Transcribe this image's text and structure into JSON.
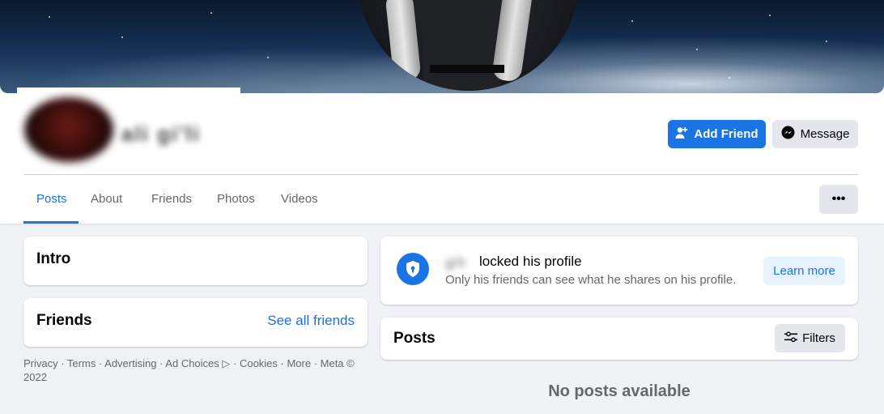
{
  "profile": {
    "name": "ali gi'li",
    "add_friend_label": "Add Friend",
    "message_label": "Message"
  },
  "tabs": [
    {
      "label": "Posts"
    },
    {
      "label": "About"
    },
    {
      "label": "Friends"
    },
    {
      "label": "Photos"
    },
    {
      "label": "Videos"
    }
  ],
  "more_label": "•••",
  "intro": {
    "title": "Intro"
  },
  "friends": {
    "title": "Friends",
    "see_all": "See all friends"
  },
  "footer": {
    "text": "Privacy · Terms · Advertising · Ad Choices ▷ · Cookies · More · Meta © 2022"
  },
  "locked": {
    "name": "gi'li",
    "title": "locked his profile",
    "subtitle": "Only his friends can see what he shares on his profile.",
    "learn_more": "Learn more"
  },
  "posts": {
    "title": "Posts",
    "filters_label": "Filters",
    "empty_text": "No posts available"
  },
  "colors": {
    "accent": "#1b74e4",
    "background": "#f0f2f5",
    "secondary_button": "#e4e6eb"
  }
}
